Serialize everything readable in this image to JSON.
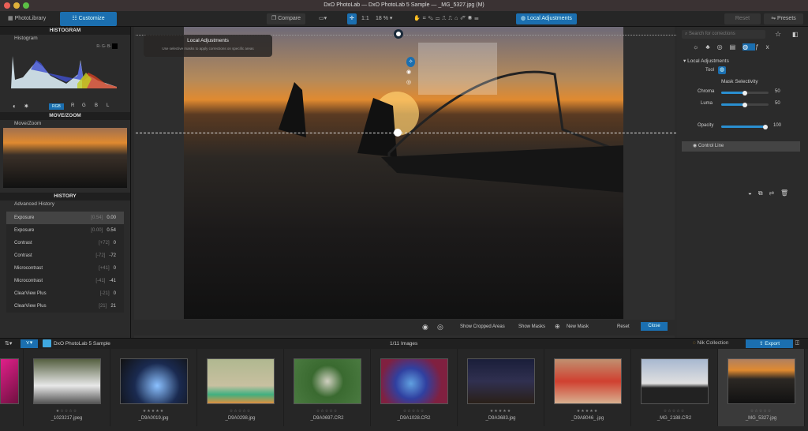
{
  "window": {
    "title": "DxO PhotoLab — DxO PhotoLab 5 Sample — _MG_5327.jpg (M)"
  },
  "toolbar": {
    "photolibrary": "PhotoLibrary",
    "customize": "Customize",
    "compare": "Compare",
    "ratio": "1:1",
    "zoom": "18 %",
    "local_adjustments": "Local Adjustments",
    "reset": "Reset",
    "presets": "Presets"
  },
  "left": {
    "histogram_header": "HISTOGRAM",
    "histogram_sub": "Histogram",
    "channels_label": "R- G- B-",
    "channel_buttons": [
      "RGB",
      "R",
      "G",
      "B",
      "L"
    ],
    "movezoom_header": "MOVE/ZOOM",
    "movezoom_sub": "Move/Zoom",
    "history_header": "HISTORY",
    "history_sub": "Advanced History",
    "history": [
      {
        "name": "Exposure",
        "prev": "[0.54]",
        "value": "0.00"
      },
      {
        "name": "Exposure",
        "prev": "[0.00]",
        "value": "0.54"
      },
      {
        "name": "Contrast",
        "prev": "[+72]",
        "value": "0"
      },
      {
        "name": "Contrast",
        "prev": "[-72]",
        "value": "-72"
      },
      {
        "name": "Microcontrast",
        "prev": "[+41]",
        "value": "0"
      },
      {
        "name": "Microcontrast",
        "prev": "[-41]",
        "value": "-41"
      },
      {
        "name": "ClearView Plus",
        "prev": "[-21]",
        "value": "0"
      },
      {
        "name": "ClearView Plus",
        "prev": "[21]",
        "value": "21"
      }
    ]
  },
  "viewer": {
    "tooltip_title": "Local Adjustments",
    "tooltip_text": "Use selective masks to apply corrections on specific areas",
    "show_cropped": "Show Cropped Areas",
    "show_masks": "Show Masks",
    "new_mask": "New Mask",
    "reset": "Reset",
    "close": "Close"
  },
  "right": {
    "search_placeholder": "Search for corrections",
    "section": "Local Adjustments",
    "tool_label": "Tool",
    "mask_selectivity": "Mask Selectivity",
    "chroma_label": "Chroma",
    "chroma_value": "50",
    "chroma": 50,
    "luma_label": "Luma",
    "luma_value": "50",
    "luma": 50,
    "opacity_label": "Opacity",
    "opacity_value": "100",
    "opacity": 100,
    "mask_item": "Control Line"
  },
  "filmstrip": {
    "folder": "DxO PhotoLab 5 Sample",
    "count": "1/11 Images",
    "nik": "Nik Collection",
    "export": "Export",
    "items": [
      {
        "name": "",
        "stars": "",
        "bg": "linear-gradient(135deg,#e0208a,#701040)"
      },
      {
        "name": "_1023217.jpeg",
        "stars": "★☆☆☆☆",
        "bg": "linear-gradient(180deg,#556040,#e8e8e8 60%,#555)"
      },
      {
        "name": "_D9A0019.jpg",
        "stars": "★★★★★",
        "bg": "radial-gradient(circle at 55% 60%,#8ac0ff,#1a2a50 50%,#111)"
      },
      {
        "name": "_D9A0298.jpg",
        "stars": "☆☆☆☆☆",
        "bg": "linear-gradient(180deg,#b0b890,#c8c0a0 60%,#40b080 80%,#e09040)"
      },
      {
        "name": "_D9A0697.CR2",
        "stars": "☆☆☆☆☆",
        "bg": "radial-gradient(circle at 50% 50%,#d0d0c0,#3a6a30 40%,#4a7a40)"
      },
      {
        "name": "_D9A1028.CR2",
        "stars": "☆☆☆☆☆",
        "bg": "radial-gradient(circle at 45% 55%,#60a0e0,#3040a0 35%,#802040 70%)"
      },
      {
        "name": "_D9A3683.jpg",
        "stars": "★★★★★",
        "bg": "linear-gradient(180deg,#1a1e3a,#303050 50%,#2a2018)"
      },
      {
        "name": "_D9A8046_.jpg",
        "stars": "★★★★★",
        "bg": "linear-gradient(180deg,#c09070,#d04030 50%,#d8b090)"
      },
      {
        "name": "_MG_2188.CR2",
        "stars": "☆☆☆☆☆",
        "bg": "linear-gradient(180deg,#a8b8d0,#e0e0e0 55%,#222 65%)"
      },
      {
        "name": "_MG_5327.jpg",
        "stars": "☆☆☆☆☆",
        "bg": "linear-gradient(180deg,#b08060,#e08a30 25%,#2c2824 45%,#111)",
        "selected": true
      }
    ]
  },
  "colors": {
    "accent": "#1b6fb0",
    "panel": "#2b2b2b"
  }
}
